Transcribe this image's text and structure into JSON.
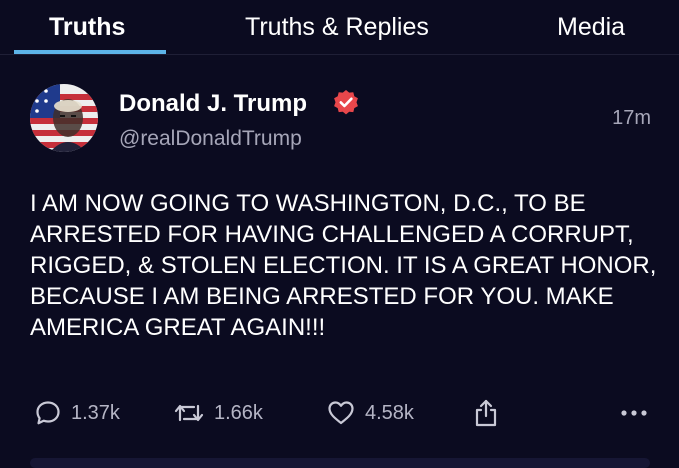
{
  "tabs": [
    {
      "label": "Truths",
      "active": true
    },
    {
      "label": "Truths & Replies",
      "active": false
    },
    {
      "label": "Media",
      "active": false
    }
  ],
  "colors": {
    "background": "#0b0b20",
    "tab_indicator": "#5db4e8",
    "verified_badge": "#e8474b",
    "secondary_text": "#a6a6b8"
  },
  "post": {
    "author": {
      "name": "Donald J. Trump",
      "handle": "@realDonaldTrump",
      "verified": true,
      "avatar_icon": "flag-portrait-avatar"
    },
    "time": "17m",
    "text": "I AM NOW GOING TO WASHINGTON, D.C., TO BE ARRESTED FOR HAVING CHALLENGED A CORRUPT, RIGGED, & STOLEN ELECTION. IT IS A GREAT HONOR, BECAUSE I AM BEING ARRESTED FOR YOU. MAKE AMERICA GREAT AGAIN!!!",
    "stats": {
      "replies": "1.37k",
      "retruths": "1.66k",
      "likes": "4.58k"
    },
    "icons": {
      "reply": "speech-bubble-icon",
      "retruth": "retruth-arrows-icon",
      "like": "heart-icon",
      "share": "share-icon",
      "more": "more-dots-icon"
    }
  }
}
